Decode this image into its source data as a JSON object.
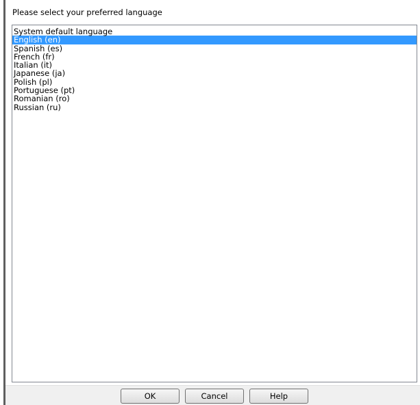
{
  "dialog": {
    "prompt": "Please select your preferred language"
  },
  "languages": {
    "selected_index": 1,
    "items": [
      "System default language",
      "English (en)",
      "Spanish (es)",
      "French (fr)",
      "Italian (it)",
      "Japanese (ja)",
      "Polish (pl)",
      "Portuguese (pt)",
      "Romanian (ro)",
      "Russian (ru)"
    ]
  },
  "buttons": {
    "ok": "OK",
    "cancel": "Cancel",
    "help": "Help"
  },
  "colors": {
    "selection_bg": "#3399ff",
    "selection_text": "#ffffff"
  }
}
